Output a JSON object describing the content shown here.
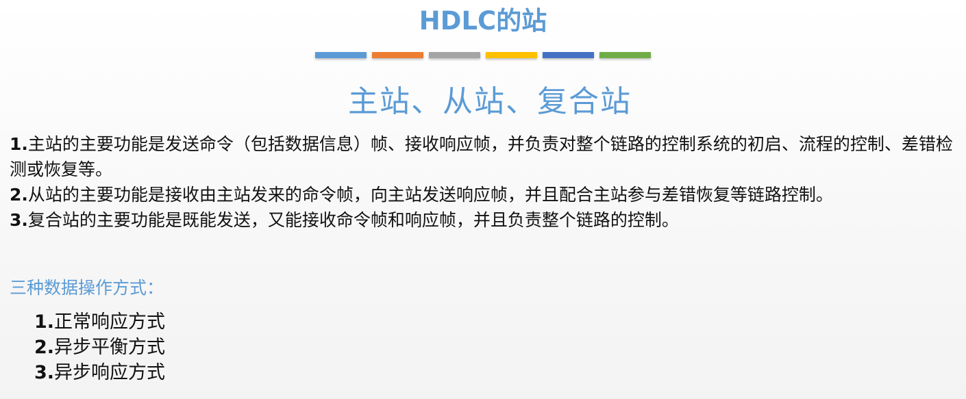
{
  "title": "HDLC的站",
  "colors": {
    "accent": "#5b9bd5",
    "body_text": "#111111"
  },
  "color_bars": [
    "#5b9bd5",
    "#ed7d31",
    "#a5a5a5",
    "#ffc000",
    "#4472c4",
    "#70ad47"
  ],
  "subtitle": "主站、从站、复合站",
  "paragraphs": [
    {
      "num": "1.",
      "text": "主站的主要功能是发送命令（包括数据信息）帧、接收响应帧，并负责对整个链路的控制系统的初启、流程的控制、差错检测或恢复等。"
    },
    {
      "num": "2.",
      "text": "从站的主要功能是接收由主站发来的命令帧，向主站发送响应帧，并且配合主站参与差错恢复等链路控制。"
    },
    {
      "num": "3.",
      "text": "复合站的主要功能是既能发送，又能接收命令帧和响应帧，并且负责整个链路的控制。"
    }
  ],
  "modes_heading": "三种数据操作方式：",
  "modes": [
    {
      "num": "1.",
      "text": "正常响应方式"
    },
    {
      "num": "2.",
      "text": "异步平衡方式"
    },
    {
      "num": "3.",
      "text": "异步响应方式"
    }
  ]
}
